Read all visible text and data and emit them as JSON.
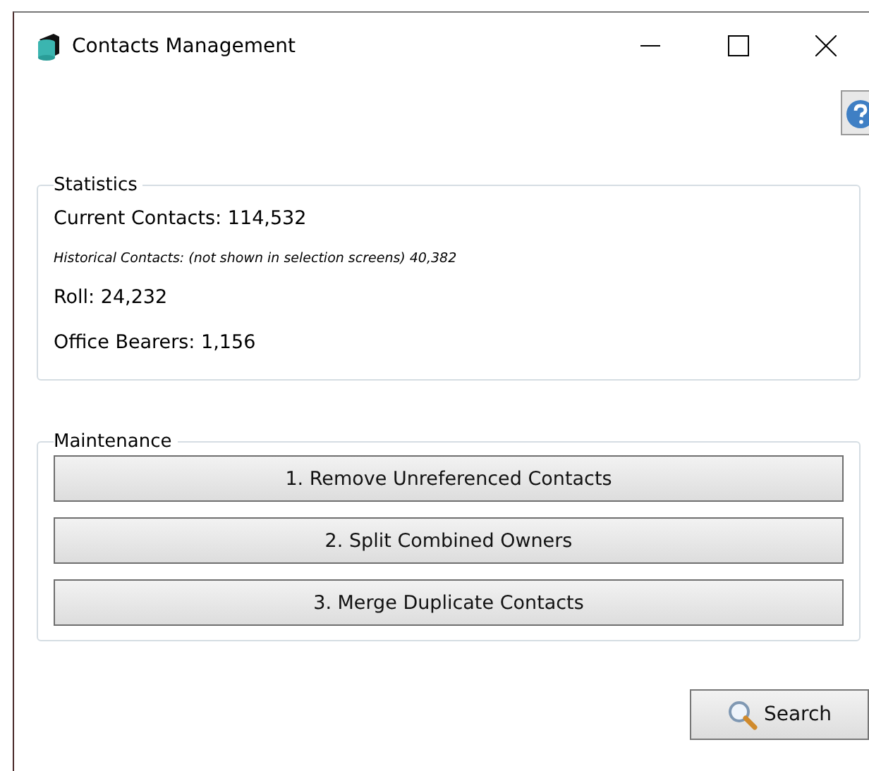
{
  "window": {
    "title": "Contacts Management"
  },
  "statistics": {
    "title": "Statistics",
    "lines": [
      {
        "text": "Current Contacts: 114,532",
        "kind": "normal"
      },
      {
        "text": "Historical Contacts: (not shown in selection screens) 40,382",
        "kind": "note"
      },
      {
        "text": "Roll: 24,232",
        "kind": "normal"
      },
      {
        "text": "Office Bearers: 1,156",
        "kind": "normal"
      }
    ]
  },
  "maintenance": {
    "title": "Maintenance",
    "buttons": [
      "1. Remove Unreferenced Contacts",
      "2. Split Combined Owners",
      "3. Merge Duplicate Contacts"
    ]
  },
  "search_button": {
    "label": "Search"
  }
}
